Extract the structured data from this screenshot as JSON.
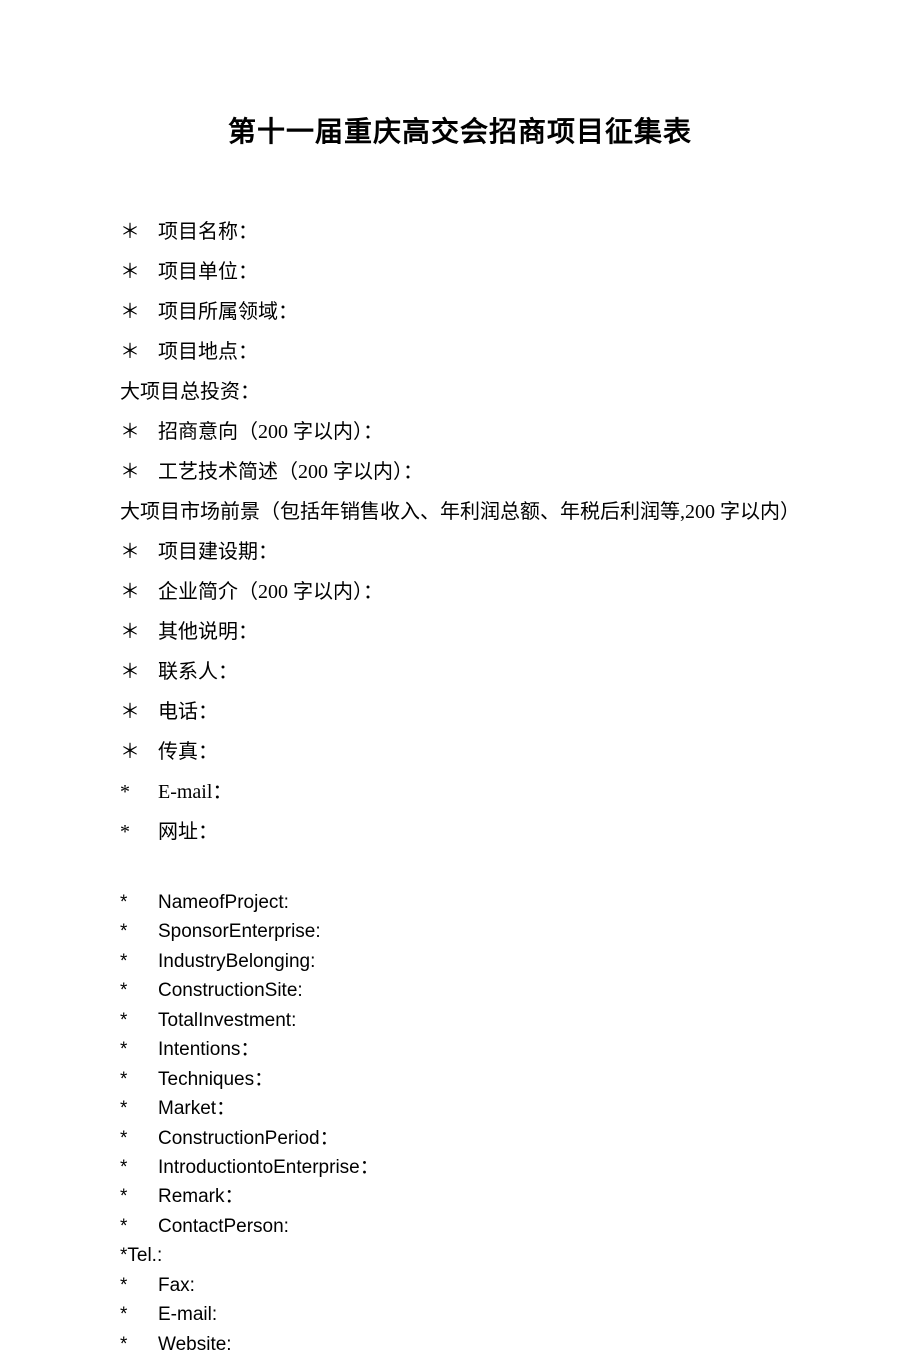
{
  "title": "第十一届重庆高交会招商项目征集表",
  "cn_fields": [
    {
      "bullet": "＊",
      "label": "项目名称："
    },
    {
      "bullet": "＊",
      "label": "项目单位："
    },
    {
      "bullet": "＊",
      "label": "项目所属领域："
    },
    {
      "bullet": "＊",
      "label": "项目地点："
    },
    {
      "bullet": "",
      "label": "大项目总投资："
    },
    {
      "bullet": "＊",
      "label": "招商意向（200 字以内）："
    },
    {
      "bullet": "＊",
      "label": "工艺技术简述（200 字以内）："
    },
    {
      "bullet": "",
      "label": "大项目市场前景（包括年销售收入、年利润总额、年税后利润等,200 字以内）"
    },
    {
      "bullet": "＊",
      "label": "项目建设期："
    },
    {
      "bullet": "＊",
      "label": "企业简介（200 字以内）："
    },
    {
      "bullet": "＊",
      "label": "其他说明："
    },
    {
      "bullet": "＊",
      "label": "联系人："
    },
    {
      "bullet": "＊",
      "label": "电话："
    },
    {
      "bullet": "＊",
      "label": "传真："
    },
    {
      "bullet": "*",
      "label": "E-mail："
    },
    {
      "bullet": "*",
      "label": "网址："
    }
  ],
  "en_fields": [
    {
      "bullet": "*",
      "label": "NameofProject:"
    },
    {
      "bullet": "*",
      "label": "SponsorEnterprise:"
    },
    {
      "bullet": "*",
      "label": "IndustryBelonging:"
    },
    {
      "bullet": "*",
      "label": "ConstructionSite:"
    },
    {
      "bullet": "*",
      "label": "TotalInvestment:"
    },
    {
      "bullet": "*",
      "label": "Intentions："
    },
    {
      "bullet": "*",
      "label": "Techniques："
    },
    {
      "bullet": "*",
      "label": "Market："
    },
    {
      "bullet": "*",
      "label": "ConstructionPeriod："
    },
    {
      "bullet": "*",
      "label": "IntroductiontoEnterprise："
    },
    {
      "bullet": "*",
      "label": "Remark："
    },
    {
      "bullet": "*",
      "label": "ContactPerson:"
    },
    {
      "bullet": "",
      "label": "*Tel.:"
    },
    {
      "bullet": "*",
      "label": "Fax:"
    },
    {
      "bullet": "*",
      "label": "E-mail:"
    },
    {
      "bullet": "*",
      "label": "Website:"
    }
  ]
}
